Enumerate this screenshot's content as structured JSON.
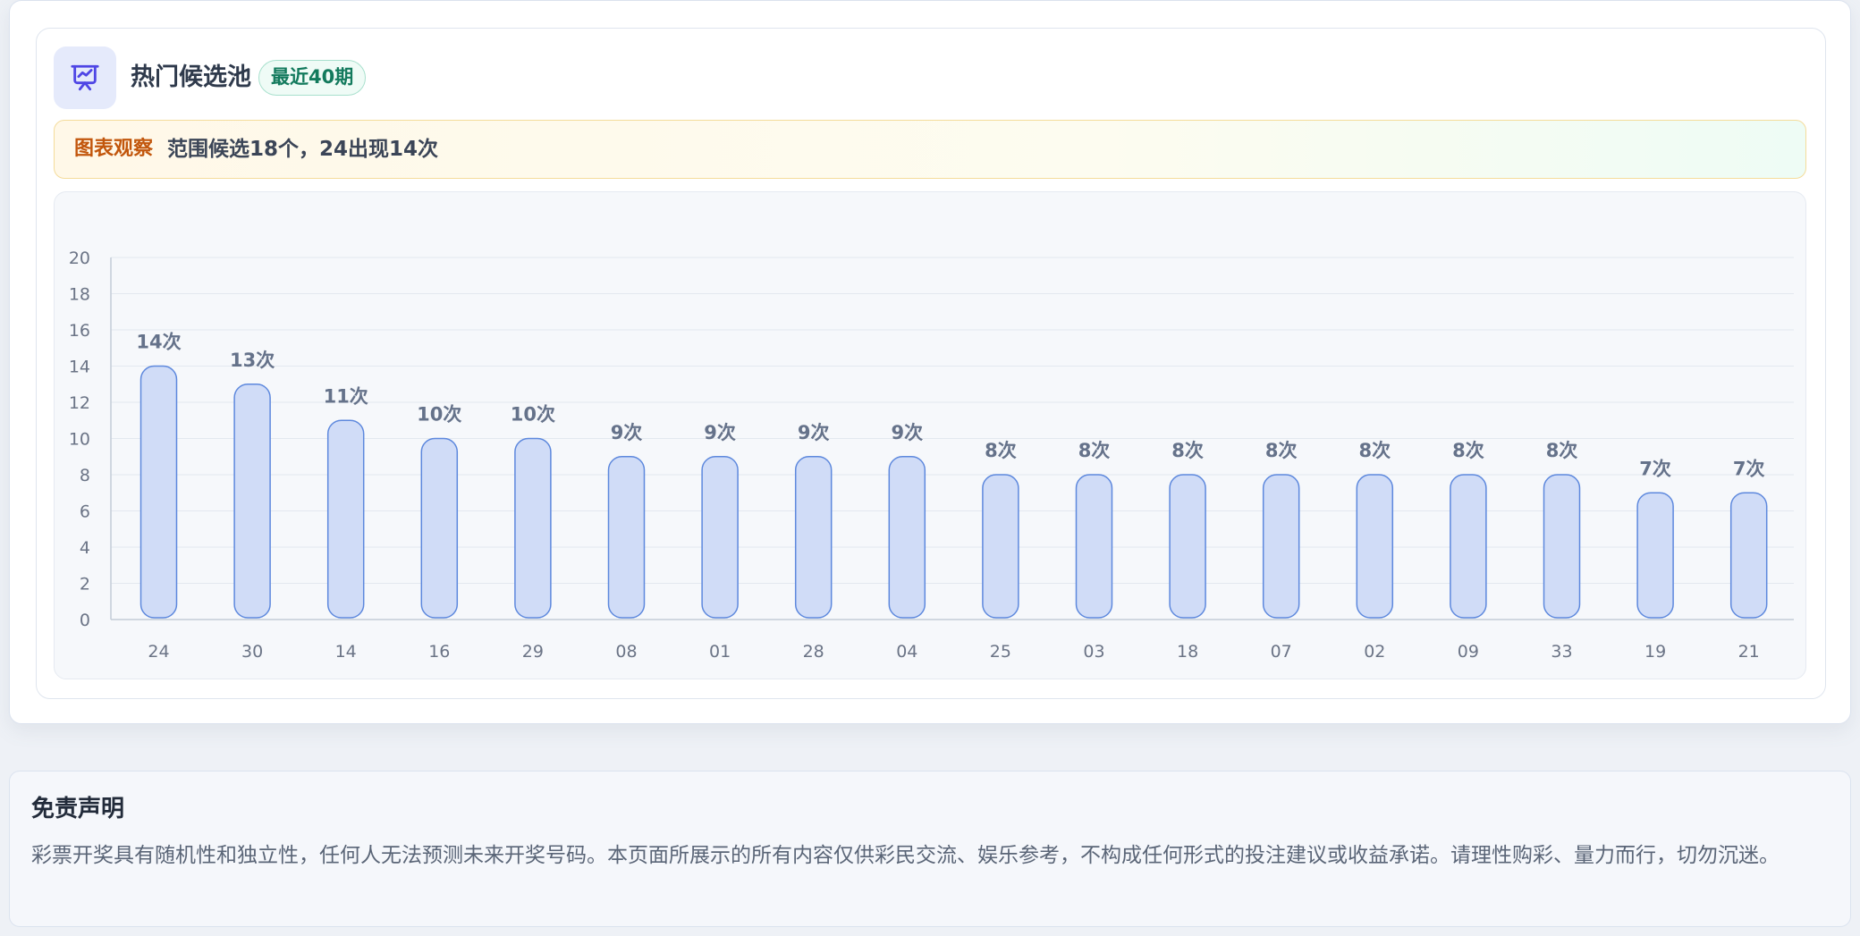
{
  "header": {
    "title": "热门候选池",
    "badge": "最近40期",
    "icon": "presentation-chart-icon"
  },
  "insight": {
    "tag": "图表观察",
    "text": "范围候选18个，24出现14次"
  },
  "colors": {
    "bar_fill": "#d0dcf7",
    "bar_stroke": "#5d88dd",
    "label": "#65728a",
    "tag": "#c2560c",
    "badge": "#137a5d"
  },
  "chart_data": {
    "type": "bar",
    "categories": [
      "24",
      "30",
      "14",
      "16",
      "29",
      "08",
      "01",
      "28",
      "04",
      "25",
      "03",
      "18",
      "07",
      "02",
      "09",
      "33",
      "19",
      "21"
    ],
    "values": [
      14,
      13,
      11,
      10,
      10,
      9,
      9,
      9,
      9,
      8,
      8,
      8,
      8,
      8,
      8,
      8,
      7,
      7
    ],
    "data_labels": [
      "14次",
      "13次",
      "11次",
      "10次",
      "10次",
      "9次",
      "9次",
      "9次",
      "9次",
      "8次",
      "8次",
      "8次",
      "8次",
      "8次",
      "8次",
      "8次",
      "7次",
      "7次"
    ],
    "ylim": [
      0,
      20
    ],
    "yticks": [
      0,
      2,
      4,
      6,
      8,
      10,
      12,
      14,
      16,
      18,
      20
    ],
    "grid": true
  },
  "disclaimer": {
    "title": "免责声明",
    "text": "彩票开奖具有随机性和独立性，任何人无法预测未来开奖号码。本页面所展示的所有内容仅供彩民交流、娱乐参考，不构成任何形式的投注建议或收益承诺。请理性购彩、量力而行，切勿沉迷。"
  }
}
